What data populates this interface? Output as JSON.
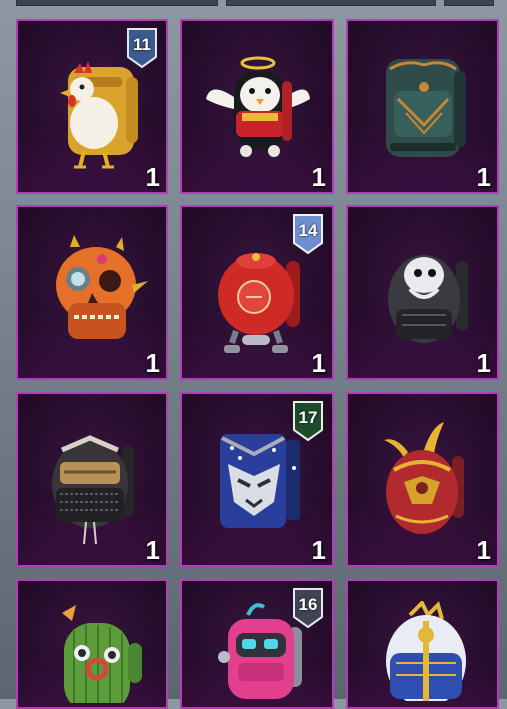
{
  "colors": {
    "tile_border": "#b23fb6",
    "tile_background": "#2b0f31",
    "page_background": "#7b8590",
    "count_text": "#ffffff"
  },
  "items": [
    {
      "icon": "rooster-backpack-icon",
      "count": "1",
      "badge": "11",
      "badge_color": "#3a5b8c"
    },
    {
      "icon": "angel-penguin-backpack-icon",
      "count": "1",
      "badge": null
    },
    {
      "icon": "teal-ornate-backpack-icon",
      "count": "1",
      "badge": null
    },
    {
      "icon": "skull-backpack-icon",
      "count": "1",
      "badge": null
    },
    {
      "icon": "red-robot-backpack-icon",
      "count": "1",
      "badge": "14",
      "badge_color": "#8fb0e0"
    },
    {
      "icon": "black-skull-backpack-icon",
      "count": "1",
      "badge": null
    },
    {
      "icon": "samurai-backpack-icon",
      "count": "1",
      "badge": null
    },
    {
      "icon": "blue-mask-backpack-icon",
      "count": "1",
      "badge": "17",
      "badge_color": "#1e4a2c"
    },
    {
      "icon": "golden-wing-backpack-icon",
      "count": "1",
      "badge": null
    },
    {
      "icon": "cactus-backpack-icon",
      "count": null,
      "badge": null
    },
    {
      "icon": "pink-robot-backpack-icon",
      "count": null,
      "badge": "16",
      "badge_color": "#3d4554"
    },
    {
      "icon": "white-gold-backpack-icon",
      "count": null,
      "badge": null
    }
  ]
}
